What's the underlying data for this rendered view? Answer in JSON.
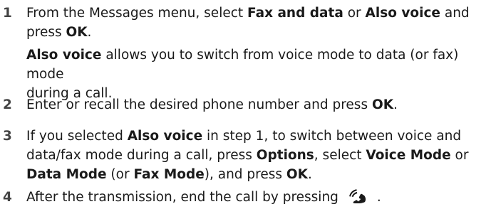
{
  "steps": [
    {
      "number": "1",
      "lines": [
        {
          "t1": "From the Messages menu, select ",
          "b1": "Fax and data",
          "t2": " or ",
          "b2": "Also voice",
          "t3": " and"
        },
        {
          "t1": "press ",
          "b1": "OK",
          "t2": "."
        }
      ],
      "note": {
        "b1": "Also voice",
        "t1": " allows you to switch from voice mode to data (or fax) mode",
        "t2": "during a call."
      }
    },
    {
      "number": "2",
      "t1": "Enter or recall the desired phone number and press ",
      "b1": "OK",
      "t2": "."
    },
    {
      "number": "3",
      "line1": {
        "t1": "If you selected ",
        "b1": "Also voice",
        "t2": " in step 1, to switch between voice and"
      },
      "line2": {
        "t1": "data/fax mode during a call, press ",
        "b1": "Options",
        "t2": ", select ",
        "b2": "Voice Mode",
        "t3": " or"
      },
      "line3": {
        "b1": "Data Mode",
        "t1": " (or ",
        "b2": "Fax Mode",
        "t2": "), and press ",
        "b3": "OK",
        "t3": "."
      }
    },
    {
      "number": "4",
      "t1": "After the transmission, end the call by pressing",
      "icon": "end-call-handset-icon",
      "t2": "."
    }
  ],
  "colors": {
    "text": "#1a1a1a",
    "number": "#444444"
  }
}
